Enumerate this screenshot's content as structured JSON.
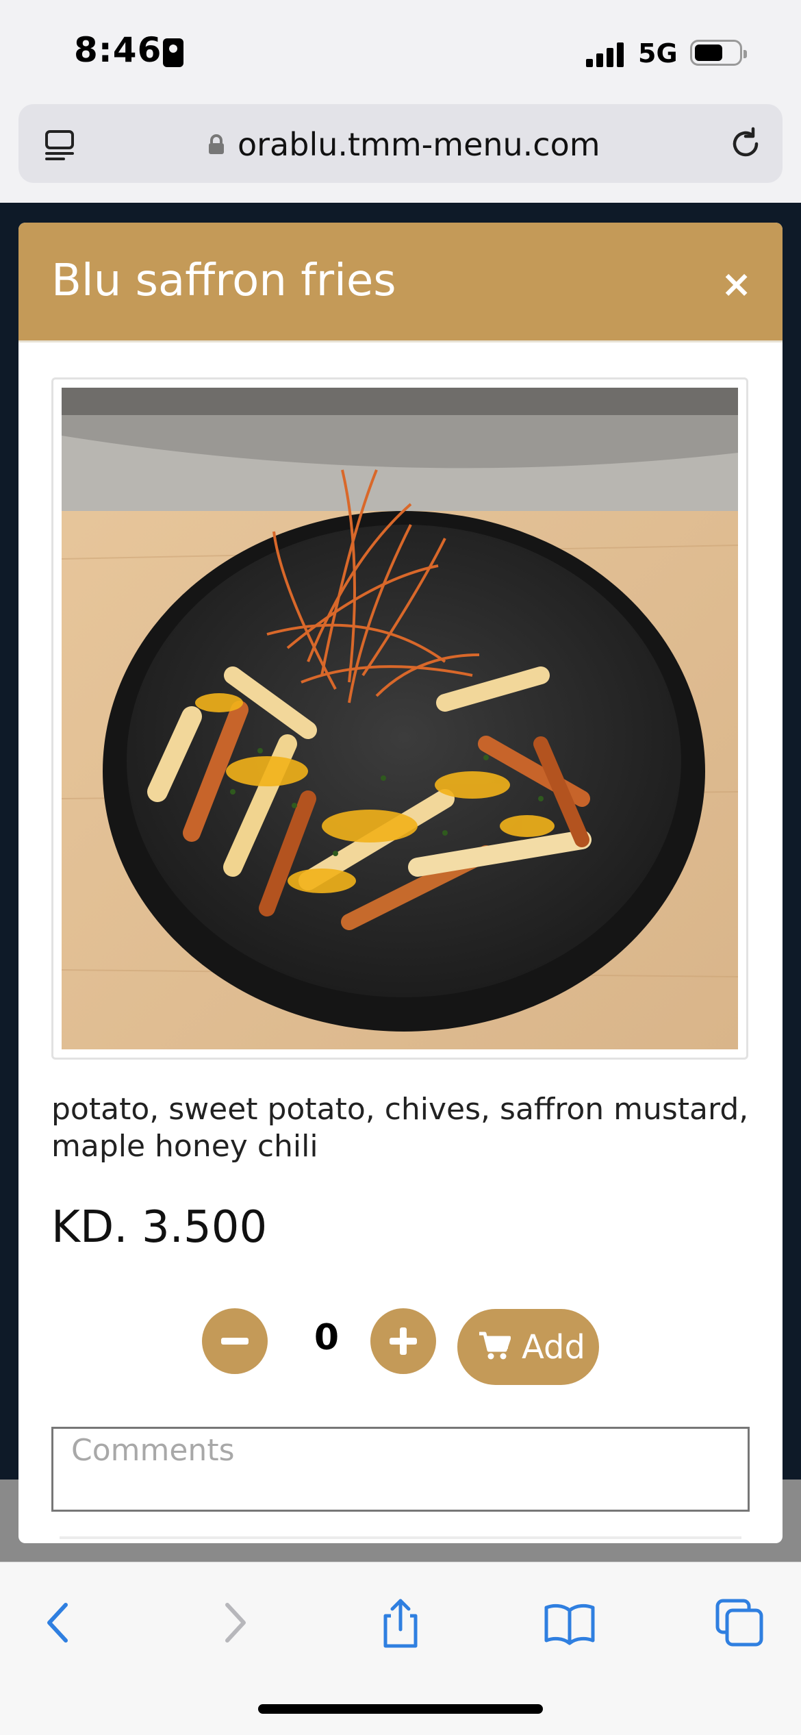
{
  "status_bar": {
    "time": "8:46",
    "network": "5G"
  },
  "browser": {
    "url": "orablu.tmm-menu.com"
  },
  "modal": {
    "title": "Blu saffron fries",
    "close_label": "×",
    "description": "potato, sweet potato, chives, saffron mustard, maple honey chili",
    "price": "KD. 3.500",
    "quantity": "0",
    "add_label": "Add",
    "comments_placeholder": "Comments"
  },
  "colors": {
    "accent": "#c49a58",
    "page_background": "#0e1a28",
    "toolbar_blue": "#2f7fe0"
  },
  "icons": [
    "id-badge-icon",
    "signal-icon",
    "battery-icon",
    "tabs-icon",
    "lock-icon",
    "reload-icon",
    "close-icon",
    "minus-icon",
    "plus-icon",
    "cart-icon",
    "back-icon",
    "forward-icon",
    "share-icon",
    "bookmarks-icon",
    "tabs-overview-icon"
  ]
}
